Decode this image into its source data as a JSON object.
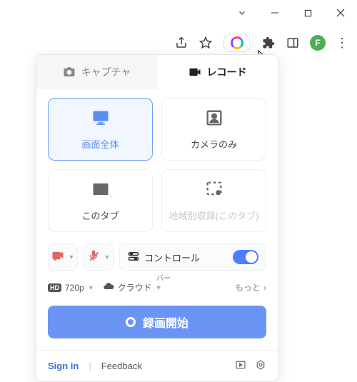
{
  "window": {
    "avatar_letter": "F"
  },
  "tabs": {
    "capture": "キャプチャ",
    "record": "レコード"
  },
  "cards": {
    "fullscreen": "画面全体",
    "camera_only": "カメラのみ",
    "this_tab": "このタブ",
    "region_tab": "地域別収録(このタブ)"
  },
  "controls": {
    "control_label": "コントロール"
  },
  "settings": {
    "resolution": "720p",
    "storage": "クラウド",
    "bar_label": "バー",
    "more": "もっと"
  },
  "record_button": "録画開始",
  "footer": {
    "signin": "Sign in",
    "feedback": "Feedback"
  }
}
